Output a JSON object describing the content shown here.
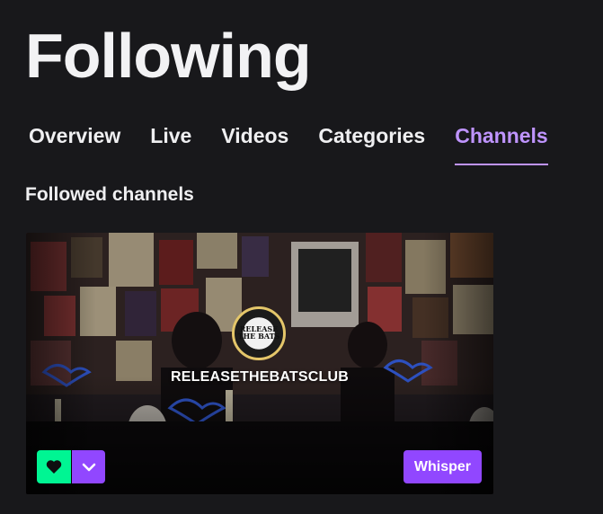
{
  "page": {
    "title": "Following"
  },
  "tabs": [
    {
      "label": "Overview",
      "active": false
    },
    {
      "label": "Live",
      "active": false
    },
    {
      "label": "Videos",
      "active": false
    },
    {
      "label": "Categories",
      "active": false
    },
    {
      "label": "Channels",
      "active": true
    }
  ],
  "section": {
    "title": "Followed channels"
  },
  "channel_card": {
    "name": "RELEASETHEBATSCLUB",
    "avatar_text": "RELEASE THE BATS",
    "follow_icon": "heart-icon",
    "menu_icon": "chevron-down-icon",
    "whisper_label": "Whisper"
  },
  "colors": {
    "background": "#18181b",
    "accent": "#9147ff",
    "active_tab": "#bf94ff",
    "follow_green": "#00f593"
  }
}
